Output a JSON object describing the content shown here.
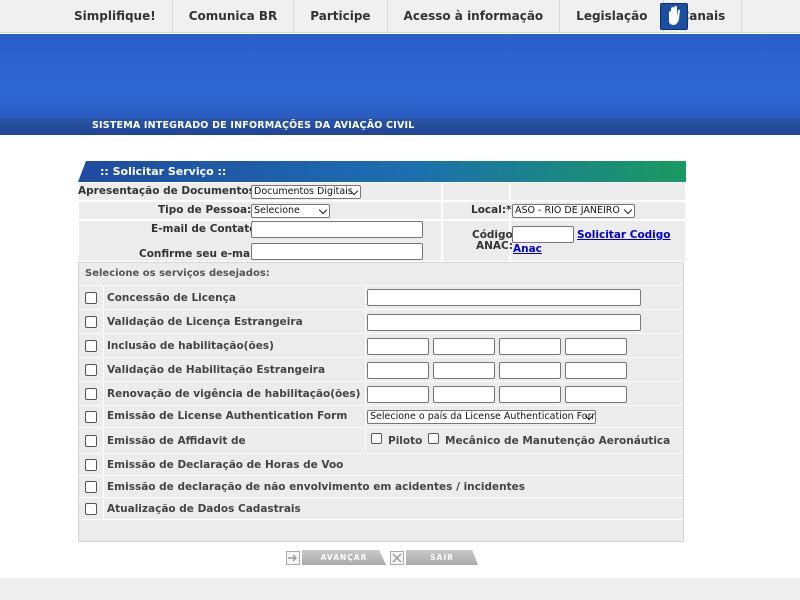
{
  "topnav": {
    "items": [
      "Simplifique!",
      "Comunica BR",
      "Participe",
      "Acesso à informação",
      "Legislação",
      "Canais"
    ],
    "libras_icon": "hand-sign-icon"
  },
  "banner": {
    "system_title": "SISTEMA INTEGRADO DE INFORMAÇÕES DA AVIAÇÃO CIVIL"
  },
  "panel": {
    "title": ":: Solicitar Serviço ::"
  },
  "form": {
    "apresentacao_label": "Apresentação de Documentos:*",
    "apresentacao_value": "Documentos Digitais",
    "tipo_pessoa_label": "Tipo de Pessoa:*",
    "tipo_pessoa_value": "Selecione",
    "local_label": "Local:*",
    "local_value": "ASO - RIO DE JANEIRO",
    "email_label": "E-mail de Contato",
    "email_value": "",
    "confirm_email_label": "Confirme seu e-mail",
    "confirm_email_value": "",
    "codigo_label_1": "Código",
    "codigo_label_2": "ANAC:",
    "codigo_value": "",
    "solicitar_link": "Solicitar Codigo",
    "anac_link": "Anac"
  },
  "services": {
    "title": "Selecione os serviços desejados:",
    "items": [
      "Concessão de Licença",
      "Validação de Licença Estrangeira",
      "Inclusão de habilitação(ões)",
      "Validação de Habilitação Estrangeira",
      "Renovação de vigência de habilitação(ões)",
      "Emissão de License Authentication Form",
      "Emissão de Affidavit de",
      "Emissão de Declaração de Horas de Voo",
      "Emissão de declaração de não envolvimento em acidentes / incidentes",
      "Atualização de Dados Cadastrais"
    ],
    "laf_select": "Selecione o país da License Authentication Form",
    "affidavit_options": [
      "Piloto",
      "Mecânico de Manutenção Aeronáutica"
    ]
  },
  "buttons": {
    "avancar": "AVANÇAR",
    "sair": "SAIR"
  },
  "colors": {
    "banner": "#2e66d3",
    "header_start": "#1f4aa2",
    "header_end": "#1a9a5f",
    "link": "#0000cc"
  }
}
